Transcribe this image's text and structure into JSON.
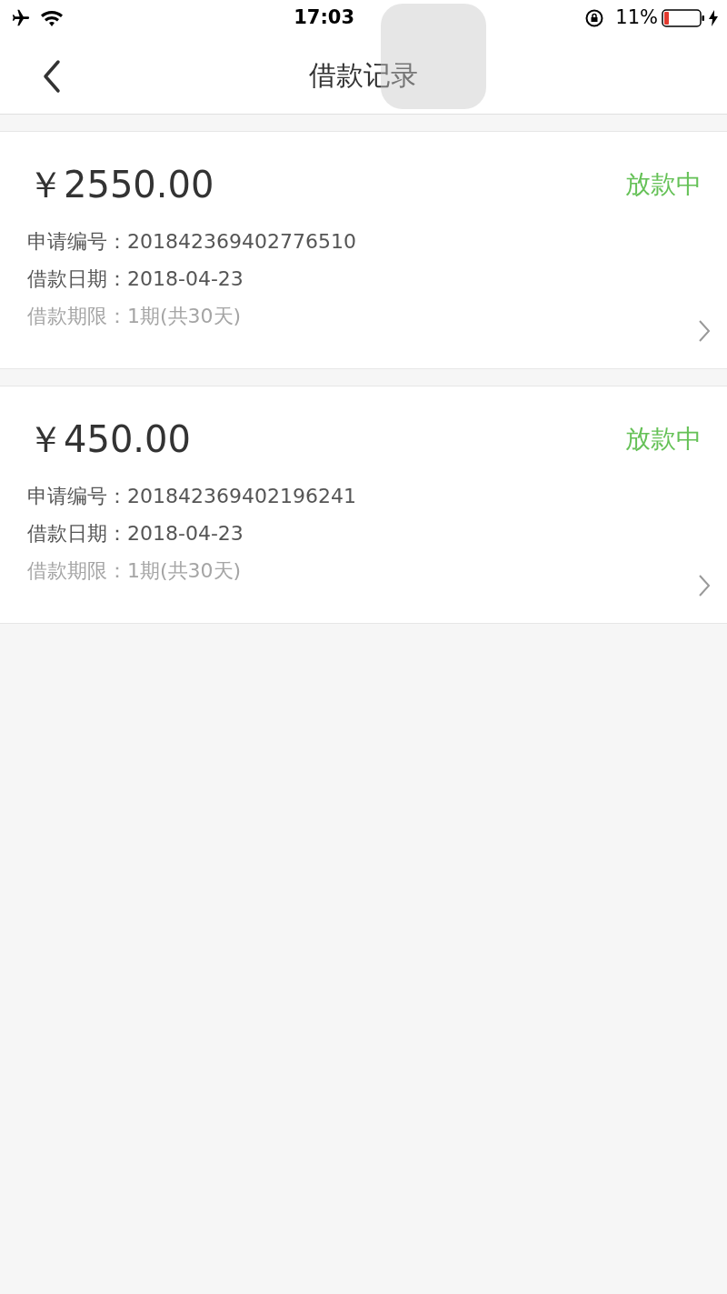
{
  "status_bar": {
    "time": "17:03",
    "battery_percent": "11%"
  },
  "nav": {
    "title": "借款记录"
  },
  "records": [
    {
      "amount": "￥2550.00",
      "status": "放款中",
      "fields": [
        {
          "label": "申请编号：",
          "value": "201842369402776510",
          "muted": false
        },
        {
          "label": "借款日期：",
          "value": "2018-04-23",
          "muted": false
        },
        {
          "label": "借款期限：",
          "value": "1期(共30天)",
          "muted": true
        }
      ]
    },
    {
      "amount": "￥450.00",
      "status": "放款中",
      "fields": [
        {
          "label": "申请编号：",
          "value": "201842369402196241",
          "muted": false
        },
        {
          "label": "借款日期：",
          "value": "2018-04-23",
          "muted": false
        },
        {
          "label": "借款期限：",
          "value": "1期(共30天)",
          "muted": true
        }
      ]
    }
  ]
}
